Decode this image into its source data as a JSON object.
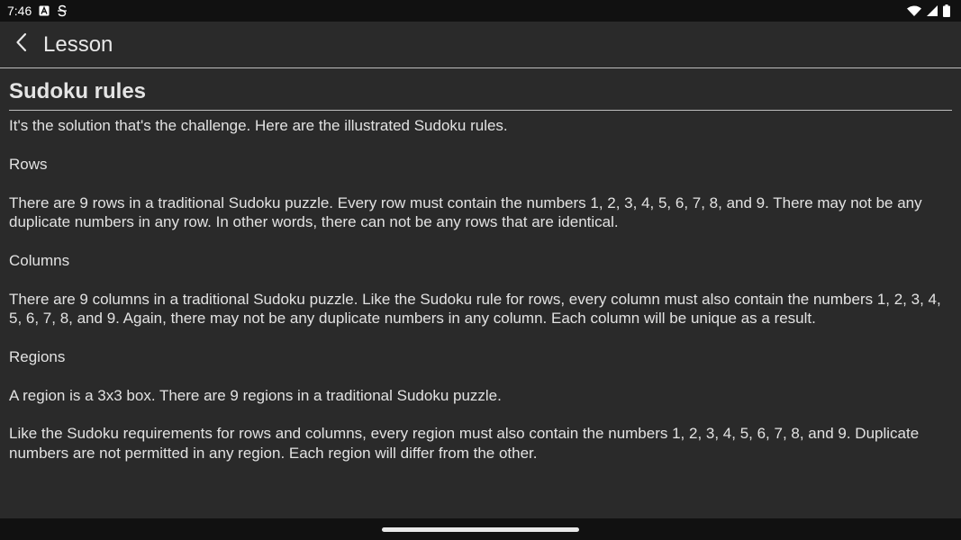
{
  "status_bar": {
    "time": "7:46",
    "icons": [
      "notification-a-icon",
      "s-icon",
      "wifi-icon",
      "signal-icon",
      "battery-icon"
    ]
  },
  "app_bar": {
    "title": "Lesson",
    "back_icon": "chevron-left-icon"
  },
  "lesson": {
    "heading": "Sudoku rules",
    "paragraphs": [
      "It's the solution that's the challenge. Here are the illustrated Sudoku rules.",
      "Rows",
      "There are 9 rows in a traditional Sudoku puzzle. Every row must contain the numbers 1, 2, 3, 4, 5, 6, 7, 8, and 9. There may not be any duplicate numbers in any row. In other words, there can not be any rows that are identical.",
      "Columns",
      "There are 9 columns in a traditional Sudoku puzzle. Like the Sudoku rule for rows, every column must also contain the numbers 1, 2, 3, 4, 5, 6, 7, 8, and 9. Again, there may not be any duplicate numbers in any column. Each column will be unique as a result.",
      "Regions",
      "A region is a 3x3 box. There are 9 regions in a traditional Sudoku puzzle.",
      "Like the Sudoku requirements for rows and columns, every region must also contain the numbers 1, 2, 3, 4, 5, 6, 7, 8, and 9. Duplicate numbers are not permitted in any region. Each region will differ from the other."
    ]
  },
  "colors": {
    "background": "#2a2a2a",
    "system_bars": "#111111",
    "text": "#e2e2e2",
    "divider": "#bdbdbd"
  }
}
